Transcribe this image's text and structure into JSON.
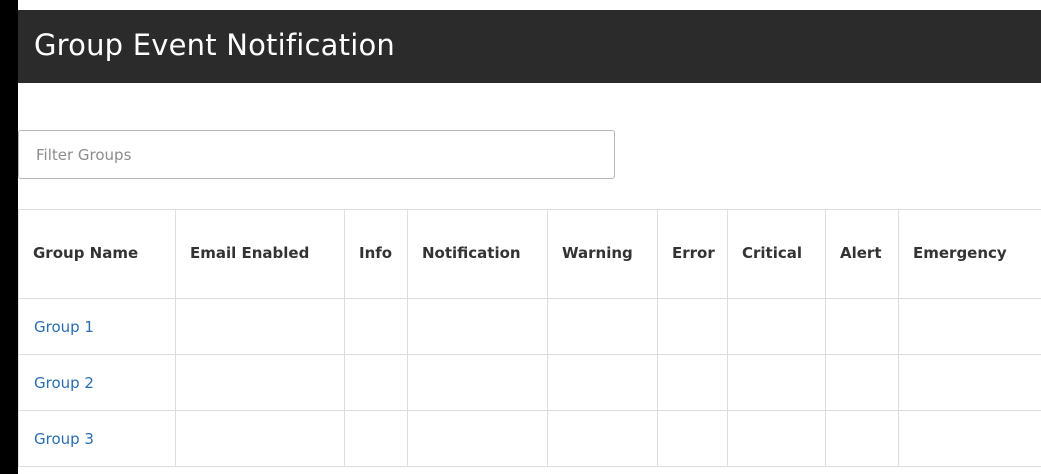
{
  "header": {
    "title": "Group Event Notification"
  },
  "filter": {
    "placeholder": "Filter Groups",
    "value": ""
  },
  "table": {
    "columns": [
      "Group Name",
      "Email Enabled",
      "Info",
      "Notification",
      "Warning",
      "Error",
      "Critical",
      "Alert",
      "Emergency"
    ],
    "rows": [
      {
        "name": "Group 1"
      },
      {
        "name": "Group 2"
      },
      {
        "name": "Group 3"
      }
    ]
  },
  "colors": {
    "header_bg": "#2b2b2b",
    "link": "#2a6eb0",
    "border": "#dedede"
  }
}
